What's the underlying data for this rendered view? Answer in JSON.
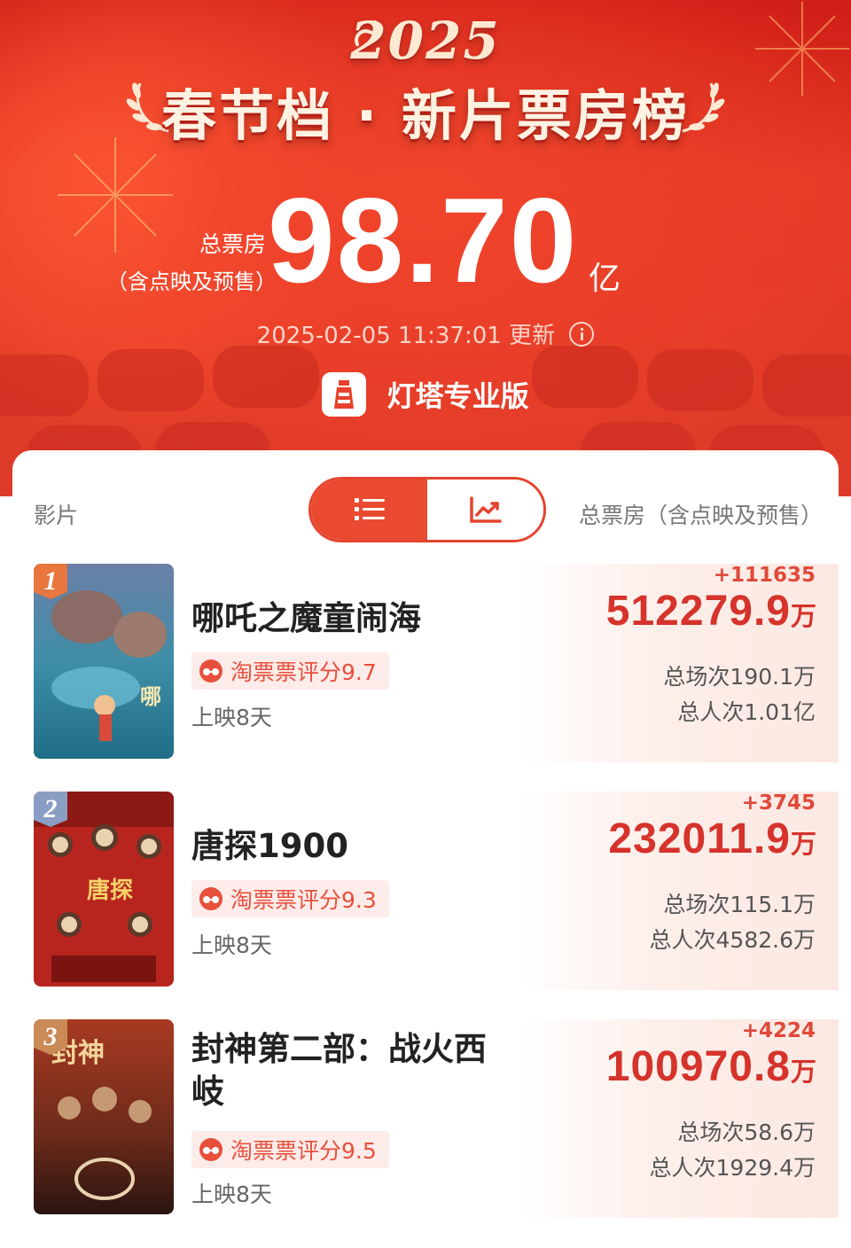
{
  "header": {
    "year": "2025",
    "title": "春节档 · 新片票房榜",
    "total_label_line1": "总票房",
    "total_label_line2": "（含点映及预售）",
    "total_value": "98.70",
    "total_unit": "亿",
    "updated_time": "2025-02-05 11:37:01",
    "updated_suffix": "更新",
    "brand": "灯塔专业版"
  },
  "table": {
    "col_film": "影片",
    "col_total": "总票房（含点映及预售）",
    "toggle_list_icon": "list-icon",
    "toggle_chart_icon": "trend-chart-icon"
  },
  "films": [
    {
      "rank": "1",
      "title": "哪吒之魔童闹海",
      "rating": "淘票票评分9.7",
      "days": "上映8天",
      "delta": "+111635",
      "box_office": "512279.9",
      "box_unit": "万",
      "sessions": "总场次190.1万",
      "admissions": "总人次1.01亿",
      "badge_color": "#e8763f"
    },
    {
      "rank": "2",
      "title": "唐探1900",
      "rating": "淘票票评分9.3",
      "days": "上映8天",
      "delta": "+3745",
      "box_office": "232011.9",
      "box_unit": "万",
      "sessions": "总场次115.1万",
      "admissions": "总人次4582.6万",
      "badge_color": "#8a9ec4"
    },
    {
      "rank": "3",
      "title": "封神第二部：战火西岐",
      "rating": "淘票票评分9.5",
      "days": "上映8天",
      "delta": "+4224",
      "box_office": "100970.8",
      "box_unit": "万",
      "sessions": "总场次58.6万",
      "admissions": "总人次1929.4万",
      "badge_color": "#c98a55"
    }
  ]
}
